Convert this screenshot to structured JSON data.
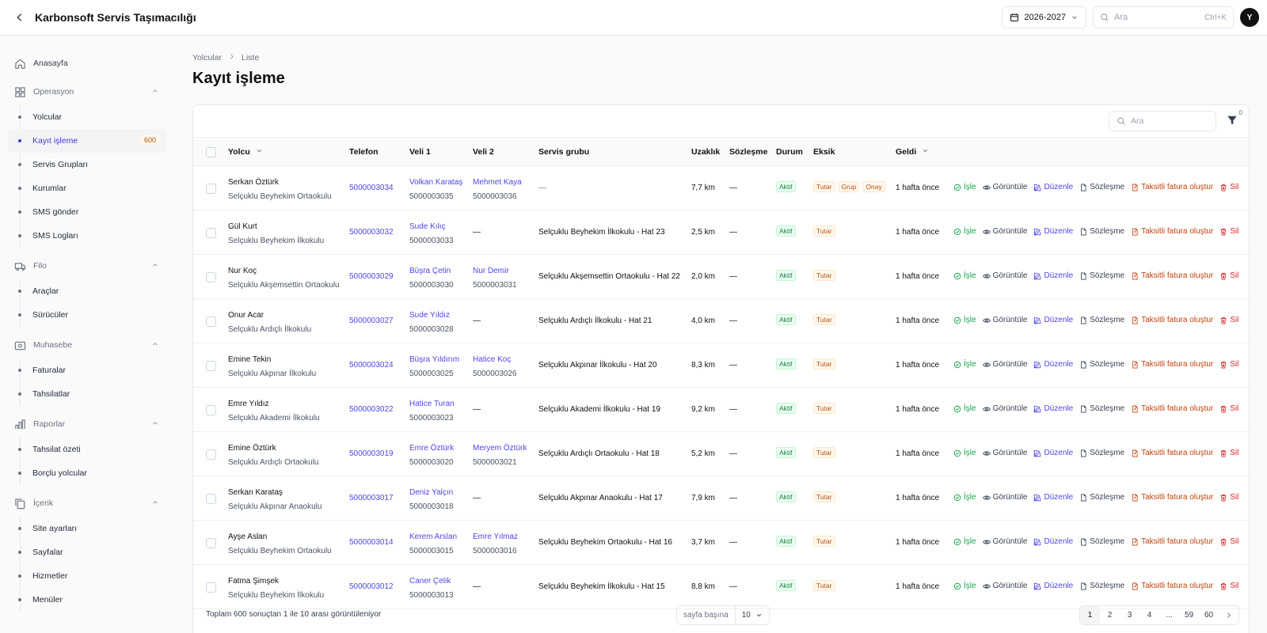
{
  "app": {
    "title": "Karbonsoft Servis Taşımacılığı"
  },
  "topbar": {
    "year": "2026-2027",
    "search_placeholder": "Ara",
    "shortcut": "Ctrl+K",
    "avatar_initial": "Y"
  },
  "sidebar": {
    "home": "Anasayfa",
    "groups": [
      {
        "label": "Operasyon",
        "icon": "grid-icon",
        "items": [
          {
            "label": "Yolcular"
          },
          {
            "label": "Kayıt işleme",
            "active": true,
            "badge": "600"
          },
          {
            "label": "Servis Grupları"
          },
          {
            "label": "Kurumlar"
          },
          {
            "label": "SMS gönder"
          },
          {
            "label": "SMS Logları"
          }
        ]
      },
      {
        "label": "Filo",
        "icon": "truck-icon",
        "items": [
          {
            "label": "Araçlar"
          },
          {
            "label": "Sürücüler"
          }
        ]
      },
      {
        "label": "Muhasebe",
        "icon": "wallet-icon",
        "items": [
          {
            "label": "Faturalar"
          },
          {
            "label": "Tahsilatlar"
          }
        ]
      },
      {
        "label": "Raporlar",
        "icon": "bar-chart-icon",
        "items": [
          {
            "label": "Tahsilat özeti"
          },
          {
            "label": "Borçlu yolcular"
          }
        ]
      },
      {
        "label": "İçerik",
        "icon": "copy-icon",
        "items": [
          {
            "label": "Site ayarları"
          },
          {
            "label": "Sayfalar"
          },
          {
            "label": "Hizmetler"
          },
          {
            "label": "Menüler"
          }
        ]
      }
    ]
  },
  "breadcrumb": {
    "parent": "Yolcular",
    "current": "Liste"
  },
  "page": {
    "title": "Kayıt işleme"
  },
  "table": {
    "search_placeholder": "Ara",
    "filter_count": "0",
    "columns": {
      "yolcu": "Yolcu",
      "telefon": "Telefon",
      "veli1": "Veli 1",
      "veli2": "Veli 2",
      "servis": "Servis grubu",
      "uzaklik": "Uzaklık",
      "sozlesme": "Sözleşme",
      "durum": "Durum",
      "eksik": "Eksik",
      "geldi": "Geldi"
    },
    "actions": {
      "isle": "İşle",
      "goruntule": "Görüntüle",
      "duzenle": "Düzenle",
      "sozlesme": "Sözleşme",
      "taksitli": "Taksitli fatura oluştur",
      "sil": "Sil"
    },
    "rows": [
      {
        "name": "Serkan Öztürk",
        "school": "Selçuklu Beyhekim Ortaokulu",
        "phone": "5000003034",
        "v1name": "Volkan Karataş",
        "v1phone": "5000003035",
        "v2name": "Mehmet Kaya",
        "v2phone": "5000003036",
        "group": "—",
        "dist": "7,7 km",
        "contract": "—",
        "status": "Aktif",
        "missing": [
          "Tutar",
          "Grup",
          "Onay"
        ],
        "arrived": "1 hafta önce"
      },
      {
        "name": "Gül Kurt",
        "school": "Selçuklu Beyhekim İlkokulu",
        "phone": "5000003032",
        "v1name": "Sude Kılıç",
        "v1phone": "5000003033",
        "v2name": "—",
        "v2phone": "",
        "group": "Selçuklu Beyhekim İlkokulu - Hat 23",
        "dist": "2,5 km",
        "contract": "—",
        "status": "Aktif",
        "missing": [
          "Tutar"
        ],
        "arrived": "1 hafta önce"
      },
      {
        "name": "Nur Koç",
        "school": "Selçuklu Akşemsettin Ortaokulu",
        "phone": "5000003029",
        "v1name": "Büşra Çetin",
        "v1phone": "5000003030",
        "v2name": "Nur Demir",
        "v2phone": "5000003031",
        "group": "Selçuklu Akşemsettin Ortaokulu - Hat 22",
        "dist": "2,0 km",
        "contract": "—",
        "status": "Aktif",
        "missing": [
          "Tutar"
        ],
        "arrived": "1 hafta önce"
      },
      {
        "name": "Onur Acar",
        "school": "Selçuklu Ardıçlı İlkokulu",
        "phone": "5000003027",
        "v1name": "Sude Yıldız",
        "v1phone": "5000003028",
        "v2name": "—",
        "v2phone": "",
        "group": "Selçuklu Ardıçlı İlkokulu - Hat 21",
        "dist": "4,0 km",
        "contract": "—",
        "status": "Aktif",
        "missing": [
          "Tutar"
        ],
        "arrived": "1 hafta önce"
      },
      {
        "name": "Emine Tekin",
        "school": "Selçuklu Akpınar İlkokulu",
        "phone": "5000003024",
        "v1name": "Büşra Yıldırım",
        "v1phone": "5000003025",
        "v2name": "Hatice Koç",
        "v2phone": "5000003026",
        "group": "Selçuklu Akpınar İlkokulu - Hat 20",
        "dist": "8,3 km",
        "contract": "—",
        "status": "Aktif",
        "missing": [
          "Tutar"
        ],
        "arrived": "1 hafta önce"
      },
      {
        "name": "Emre Yıldız",
        "school": "Selçuklu Akademi İlkokulu",
        "phone": "5000003022",
        "v1name": "Hatice Turan",
        "v1phone": "5000003023",
        "v2name": "—",
        "v2phone": "",
        "group": "Selçuklu Akademi İlkokulu - Hat 19",
        "dist": "9,2 km",
        "contract": "—",
        "status": "Aktif",
        "missing": [
          "Tutar"
        ],
        "arrived": "1 hafta önce"
      },
      {
        "name": "Emine Öztürk",
        "school": "Selçuklu Ardıçlı Ortaokulu",
        "phone": "5000003019",
        "v1name": "Emre Öztürk",
        "v1phone": "5000003020",
        "v2name": "Meryem Öztürk",
        "v2phone": "5000003021",
        "group": "Selçuklu Ardıçlı Ortaokulu - Hat 18",
        "dist": "5,2 km",
        "contract": "—",
        "status": "Aktif",
        "missing": [
          "Tutar"
        ],
        "arrived": "1 hafta önce"
      },
      {
        "name": "Serkan Karataş",
        "school": "Selçuklu Akpınar Anaokulu",
        "phone": "5000003017",
        "v1name": "Deniz Yalçın",
        "v1phone": "5000003018",
        "v2name": "—",
        "v2phone": "",
        "group": "Selçuklu Akpınar Anaokulu - Hat 17",
        "dist": "7,9 km",
        "contract": "—",
        "status": "Aktif",
        "missing": [
          "Tutar"
        ],
        "arrived": "1 hafta önce"
      },
      {
        "name": "Ayşe Aslan",
        "school": "Selçuklu Beyhekim Ortaokulu",
        "phone": "5000003014",
        "v1name": "Kerem Arslan",
        "v1phone": "5000003015",
        "v2name": "Emre Yılmaz",
        "v2phone": "5000003016",
        "group": "Selçuklu Beyhekim Ortaokulu - Hat 16",
        "dist": "3,7 km",
        "contract": "—",
        "status": "Aktif",
        "missing": [
          "Tutar"
        ],
        "arrived": "1 hafta önce"
      },
      {
        "name": "Fatma Şimşek",
        "school": "Selçuklu Beyhekim İlkokulu",
        "phone": "5000003012",
        "v1name": "Caner Çelik",
        "v1phone": "5000003013",
        "v2name": "—",
        "v2phone": "",
        "group": "Selçuklu Beyhekim İlkokulu - Hat 15",
        "dist": "8,8 km",
        "contract": "—",
        "status": "Aktif",
        "missing": [
          "Tutar"
        ],
        "arrived": "1 hafta önce"
      }
    ]
  },
  "footer": {
    "total_text": "Toplam 600 sonuçtan 1 ile 10 arası görüntüleniyor",
    "per_page_label": "sayfa başına",
    "per_page_value": "10",
    "pages": [
      "1",
      "2",
      "3",
      "4",
      "...",
      "59",
      "60"
    ],
    "current_page": "1"
  }
}
